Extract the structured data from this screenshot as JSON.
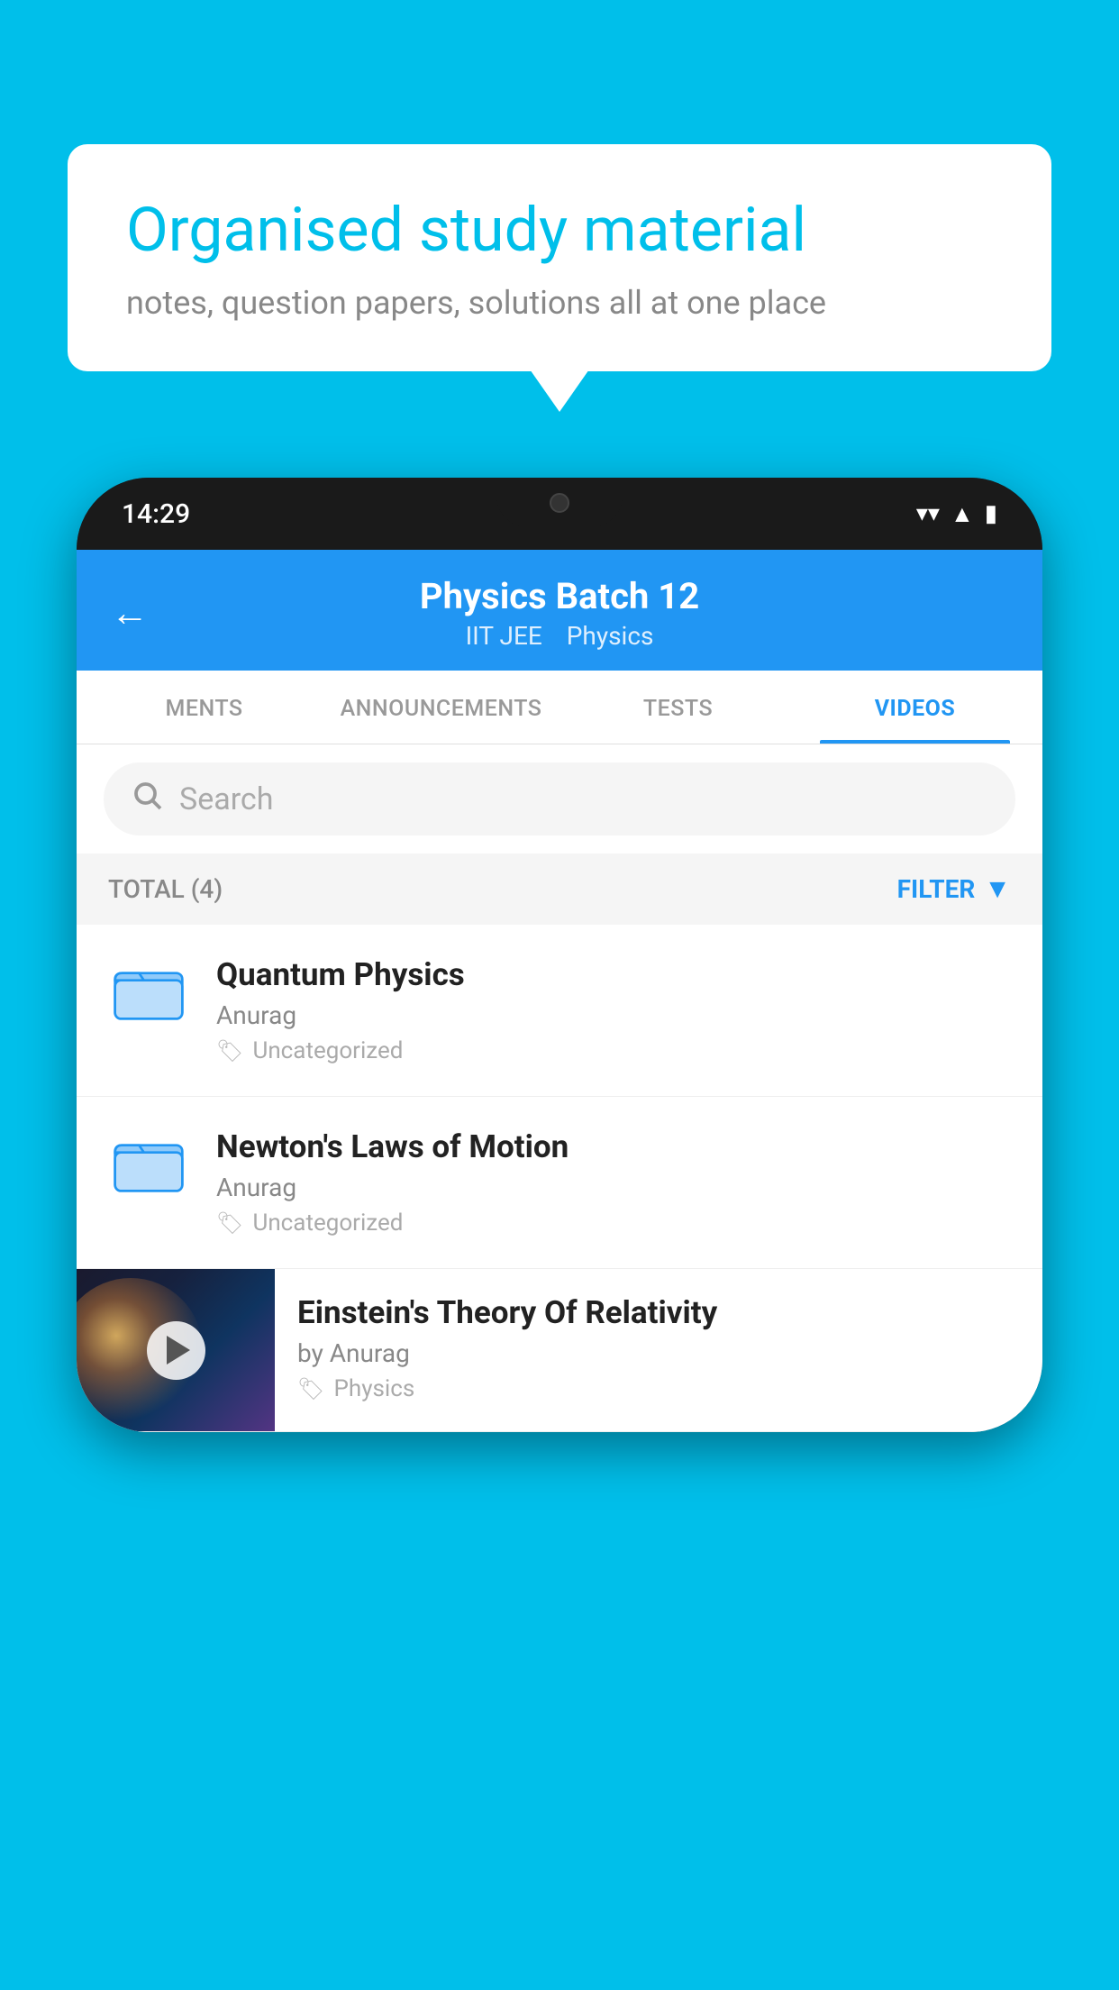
{
  "background_color": "#00BFEA",
  "speech_bubble": {
    "title": "Organised study material",
    "subtitle": "notes, question papers, solutions all at one place"
  },
  "phone": {
    "time": "14:29",
    "header": {
      "title": "Physics Batch 12",
      "subtitle_part1": "IIT JEE",
      "subtitle_part2": "Physics"
    },
    "tabs": [
      {
        "label": "MENTS",
        "active": false
      },
      {
        "label": "ANNOUNCEMENTS",
        "active": false
      },
      {
        "label": "TESTS",
        "active": false
      },
      {
        "label": "VIDEOS",
        "active": true
      }
    ],
    "search": {
      "placeholder": "Search"
    },
    "filter": {
      "total_label": "TOTAL (4)",
      "filter_label": "FILTER"
    },
    "videos": [
      {
        "id": 1,
        "title": "Quantum Physics",
        "author": "Anurag",
        "tag": "Uncategorized",
        "type": "folder"
      },
      {
        "id": 2,
        "title": "Newton's Laws of Motion",
        "author": "Anurag",
        "tag": "Uncategorized",
        "type": "folder"
      },
      {
        "id": 3,
        "title": "Einstein's Theory Of Relativity",
        "author": "by Anurag",
        "tag": "Physics",
        "type": "video"
      }
    ]
  }
}
